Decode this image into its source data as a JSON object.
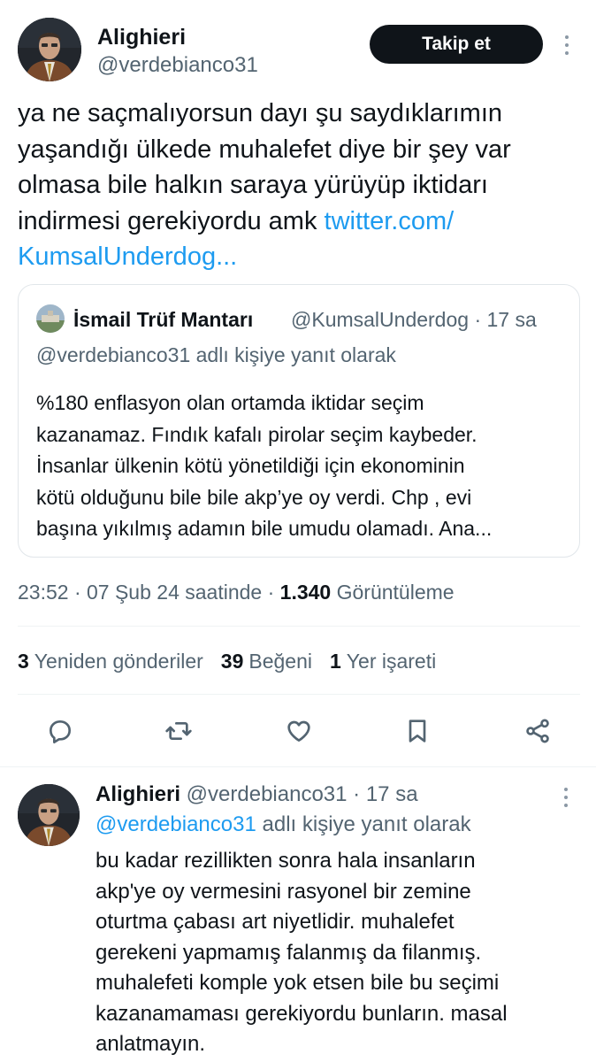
{
  "main_tweet": {
    "author_name": "Alighieri",
    "author_handle": "@verdebianco31",
    "follow_label": "Takip et",
    "text_lines": [
      "ya ne saçmalıyorsun dayı şu saydıklarımın",
      "yaşandığı ülkede muhalefet diye bir şey var",
      "olmasa bile halkın saraya yürüyüp iktidarı",
      "indirmesi gerekiyordu amk "
    ],
    "link_line1": "twitter.com/",
    "link_line2": "KumsalUnderdog..."
  },
  "quote": {
    "author_name": "İsmail Trüf Mantarı",
    "meta": "@KumsalUnderdog · 17 sa",
    "reply_to": "@verdebianco31 adlı kişiye yanıt olarak",
    "text_lines": [
      "%180 enflasyon olan ortamda iktidar seçim",
      "kazanamaz. Fındık kafalı pirolar seçim kaybeder.",
      "İnsanlar ülkenin kötü yönetildiği için ekonominin",
      "kötü olduğunu bile bile akp’ye oy verdi. Chp , evi",
      "başına yıkılmış adamın bile umudu olamadı. Ana..."
    ]
  },
  "timestamp": {
    "time_date": "23:52 · 07 Şub 24 saatinde · ",
    "views_count": "1.340",
    "views_label": " Görüntüleme"
  },
  "stats": {
    "retweets_count": "3",
    "retweets_label": "Yeniden gönderiler",
    "likes_count": "39",
    "likes_label": "Beğeni",
    "bookmarks_count": "1",
    "bookmarks_label": "Yer işareti"
  },
  "actions": {
    "icons": [
      "reply-icon",
      "retweet-icon",
      "like-icon",
      "bookmark-icon",
      "share-icon"
    ],
    "icon_color": "#536471"
  },
  "reply_tweet": {
    "author_name": "Alighieri",
    "meta": " @verdebianco31 · 17 sa",
    "reply_to_handle": "@verdebianco31",
    "reply_to_suffix": " adlı kişiye yanıt olarak",
    "text_lines": [
      "bu kadar rezillikten sonra hala insanların",
      "akp'ye oy vermesini rasyonel bir zemine",
      "oturtma çabası art niyetlidir. muhalefet",
      "gerekeni yapmamış falanmış da filanmış.",
      "muhalefeti komple yok etsen bile bu seçimi",
      "kazanamaması gerekiyordu bunların. masal",
      "anlatmayın."
    ]
  },
  "colors": {
    "accent": "#1d9bf0",
    "text_primary": "#0f1419",
    "text_secondary": "#536471",
    "follow_button_bg": "#0f1419",
    "divider": "#eff3f4"
  }
}
